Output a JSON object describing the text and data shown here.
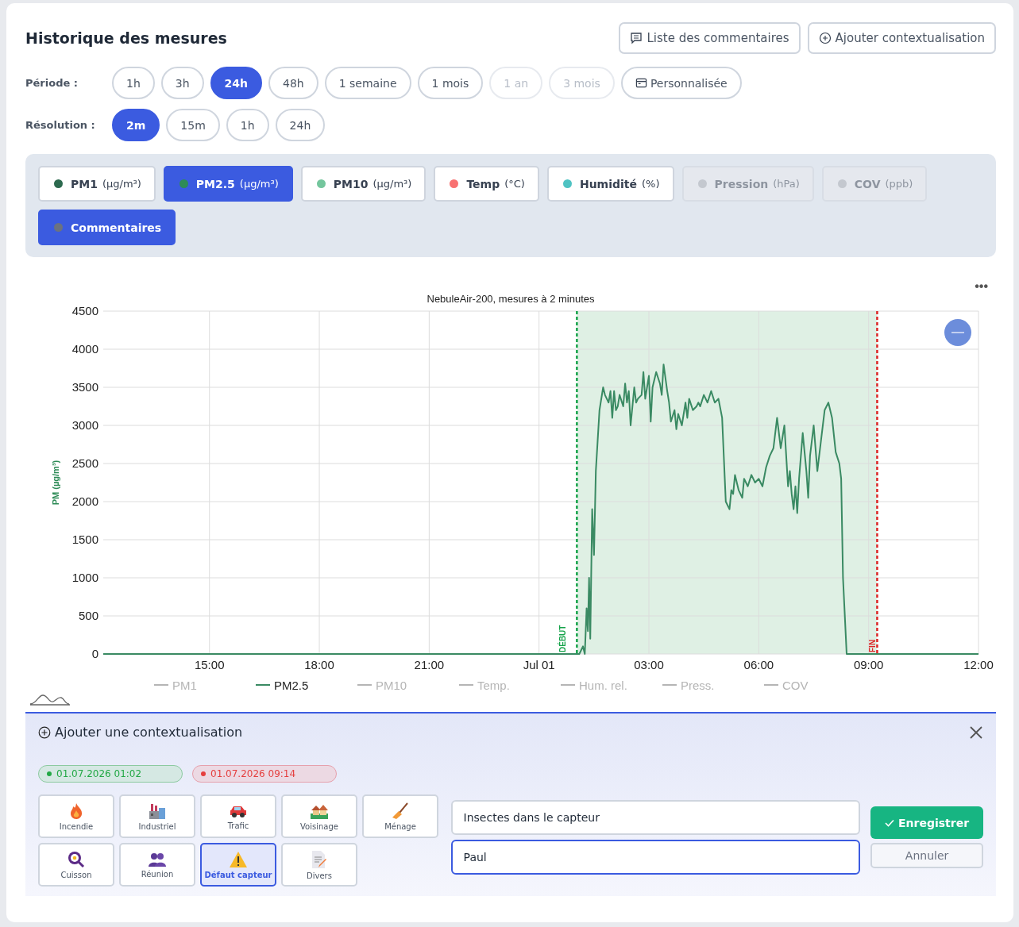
{
  "header": {
    "title": "Historique des mesures",
    "buttons": [
      {
        "label": "Liste des commentaires"
      },
      {
        "label": "Ajouter contextualisation"
      }
    ]
  },
  "period": {
    "label": "Période :",
    "options": [
      {
        "label": "1h",
        "selected": false,
        "disabled": false,
        "kind": "plain"
      },
      {
        "label": "3h",
        "selected": false,
        "disabled": false,
        "kind": "plain"
      },
      {
        "label": "24h",
        "selected": true,
        "disabled": false,
        "kind": "plain"
      },
      {
        "label": "48h",
        "selected": false,
        "disabled": false,
        "kind": "plain"
      },
      {
        "label": "1 semaine",
        "selected": false,
        "disabled": false,
        "kind": "plain"
      },
      {
        "label": "1 mois",
        "selected": false,
        "disabled": false,
        "kind": "plain"
      },
      {
        "label": "1 an",
        "selected": false,
        "disabled": true,
        "kind": "plain"
      },
      {
        "label": "3 mois",
        "selected": false,
        "disabled": true,
        "kind": "plain"
      },
      {
        "label": "Personnalisée",
        "selected": false,
        "disabled": false,
        "kind": "calendar"
      }
    ]
  },
  "resolution": {
    "label": "Résolution :",
    "options": [
      {
        "label": "2m",
        "selected": true
      },
      {
        "label": "15m",
        "selected": false
      },
      {
        "label": "1h",
        "selected": false
      },
      {
        "label": "24h",
        "selected": false
      }
    ]
  },
  "parameters": [
    {
      "label": "PM1",
      "unit": "(µg/m³)",
      "color": "#2d6a4f",
      "selected": false,
      "disabled": false
    },
    {
      "label": "PM2.5",
      "unit": "(µg/m³)",
      "color": "#2e8b57",
      "selected": true,
      "disabled": false
    },
    {
      "label": "PM10",
      "unit": "(µg/m³)",
      "color": "#74c69d",
      "selected": false,
      "disabled": false
    },
    {
      "label": "Temp",
      "unit": "(°C)",
      "color": "#f87171",
      "selected": false,
      "disabled": false
    },
    {
      "label": "Humidité",
      "unit": "(%)",
      "color": "#4fc3c3",
      "selected": false,
      "disabled": false
    },
    {
      "label": "Pression",
      "unit": "(hPa)",
      "color": "#c4c8cf",
      "selected": false,
      "disabled": true
    },
    {
      "label": "COV",
      "unit": "(ppb)",
      "color": "#c4c8cf",
      "selected": false,
      "disabled": true
    },
    {
      "label": "Commentaires",
      "color": "#6b7280",
      "selected": true,
      "disabled": false
    }
  ],
  "chart": {
    "menu": "•••",
    "legend": [
      {
        "label": "PM1",
        "visible": false
      },
      {
        "visible": true
      },
      {
        "label": "PM10",
        "visible": false
      },
      {
        "label": "Temp.",
        "visible": false
      },
      {
        "label": "Hum. rel.",
        "visible": false
      },
      {
        "label": "Press.",
        "visible": false
      },
      {
        "label": "COV",
        "visible": false
      }
    ],
    "chart_data": {
      "type": "line",
      "title": "NebuleAir-200, mesures à 2 minutes",
      "ylabel": "PM (µg/m³)",
      "grid": true,
      "xlim": [
        "2026-06-30T12:06",
        "2026-07-01T12:00"
      ],
      "ylim": [
        0,
        4500
      ],
      "xticks": [
        {
          "value": "2026-06-30T15:00",
          "label": "15:00"
        },
        {
          "value": "2026-06-30T18:00",
          "label": "18:00"
        },
        {
          "value": "2026-06-30T21:00",
          "label": "21:00"
        },
        {
          "value": "2026-07-01T00:00",
          "label": "Jul 01"
        },
        {
          "value": "2026-07-01T03:00",
          "label": "03:00"
        },
        {
          "value": "2026-07-01T06:00",
          "label": "06:00"
        },
        {
          "value": "2026-07-01T09:00",
          "label": "09:00"
        },
        {
          "value": "2026-07-01T12:00",
          "label": "12:00"
        }
      ],
      "yticks": [
        0,
        500,
        1000,
        1500,
        2000,
        2500,
        3000,
        3500,
        4000,
        4500
      ],
      "x": [
        "2026-06-30T12:06",
        "2026-07-01T01:00",
        "2026-07-01T01:06",
        "2026-07-01T01:09",
        "2026-07-01T01:12",
        "2026-07-01T01:15",
        "2026-07-01T01:18",
        "2026-07-01T01:20",
        "2026-07-01T01:22",
        "2026-07-01T01:24",
        "2026-07-01T01:27",
        "2026-07-01T01:30",
        "2026-07-01T01:33",
        "2026-07-01T01:36",
        "2026-07-01T01:39",
        "2026-07-01T01:45",
        "2026-07-01T01:48",
        "2026-07-01T01:54",
        "2026-07-01T01:57",
        "2026-07-01T02:00",
        "2026-07-01T02:03",
        "2026-07-01T02:06",
        "2026-07-01T02:09",
        "2026-07-01T02:12",
        "2026-07-01T02:18",
        "2026-07-01T02:21",
        "2026-07-01T02:24",
        "2026-07-01T02:27",
        "2026-07-01T02:30",
        "2026-07-01T02:36",
        "2026-07-01T02:39",
        "2026-07-01T02:42",
        "2026-07-01T02:48",
        "2026-07-01T02:51",
        "2026-07-01T02:54",
        "2026-07-01T03:00",
        "2026-07-01T03:03",
        "2026-07-01T03:06",
        "2026-07-01T03:12",
        "2026-07-01T03:18",
        "2026-07-01T03:21",
        "2026-07-01T03:24",
        "2026-07-01T03:30",
        "2026-07-01T03:33",
        "2026-07-01T03:36",
        "2026-07-01T03:42",
        "2026-07-01T03:45",
        "2026-07-01T03:48",
        "2026-07-01T03:54",
        "2026-07-01T04:00",
        "2026-07-01T04:03",
        "2026-07-01T04:06",
        "2026-07-01T04:12",
        "2026-07-01T04:18",
        "2026-07-01T04:21",
        "2026-07-01T04:24",
        "2026-07-01T04:30",
        "2026-07-01T04:36",
        "2026-07-01T04:42",
        "2026-07-01T04:48",
        "2026-07-01T04:54",
        "2026-07-01T05:00",
        "2026-07-01T05:06",
        "2026-07-01T05:12",
        "2026-07-01T05:15",
        "2026-07-01T05:18",
        "2026-07-01T05:21",
        "2026-07-01T05:27",
        "2026-07-01T05:33",
        "2026-07-01T05:36",
        "2026-07-01T05:42",
        "2026-07-01T05:48",
        "2026-07-01T05:54",
        "2026-07-01T06:00",
        "2026-07-01T06:06",
        "2026-07-01T06:12",
        "2026-07-01T06:18",
        "2026-07-01T06:24",
        "2026-07-01T06:30",
        "2026-07-01T06:36",
        "2026-07-01T06:42",
        "2026-07-01T06:48",
        "2026-07-01T06:51",
        "2026-07-01T06:54",
        "2026-07-01T06:57",
        "2026-07-01T07:00",
        "2026-07-01T07:03",
        "2026-07-01T07:06",
        "2026-07-01T07:12",
        "2026-07-01T07:18",
        "2026-07-01T07:21",
        "2026-07-01T07:24",
        "2026-07-01T07:30",
        "2026-07-01T07:36",
        "2026-07-01T07:42",
        "2026-07-01T07:48",
        "2026-07-01T07:54",
        "2026-07-01T08:00",
        "2026-07-01T08:06",
        "2026-07-01T08:12",
        "2026-07-01T08:15",
        "2026-07-01T08:18",
        "2026-07-01T08:24",
        "2026-07-01T08:30",
        "2026-07-01T08:36",
        "2026-07-01T08:42",
        "2026-07-01T08:45",
        "2026-07-01T08:48",
        "2026-07-01T08:51",
        "2026-07-01T12:00"
      ],
      "series": [
        {
          "name": "PM2.5",
          "color": "#3a8a63",
          "values": [
            0,
            0,
            0,
            50,
            100,
            0,
            600,
            300,
            1000,
            200,
            1900,
            1300,
            2400,
            2800,
            3200,
            3500,
            3400,
            3300,
            3450,
            3100,
            3450,
            3200,
            3250,
            3400,
            3250,
            3550,
            3300,
            3450,
            3000,
            3500,
            3300,
            3350,
            3400,
            3700,
            3350,
            3650,
            3050,
            3500,
            3700,
            3550,
            3400,
            3800,
            3450,
            3300,
            3050,
            3200,
            2950,
            3150,
            3000,
            3300,
            3100,
            3350,
            3200,
            3250,
            3300,
            3250,
            3400,
            3300,
            3450,
            3300,
            3350,
            3100,
            2000,
            1900,
            2150,
            2100,
            2350,
            2150,
            2050,
            2300,
            2200,
            2350,
            2250,
            2300,
            2200,
            2450,
            2600,
            2700,
            3100,
            2700,
            3000,
            2200,
            2400,
            2100,
            1900,
            2200,
            1850,
            2300,
            2900,
            2400,
            2050,
            2600,
            3000,
            2400,
            2800,
            3200,
            3300,
            3100,
            2650,
            2500,
            2300,
            1000,
            0,
            0,
            0,
            0,
            0,
            0,
            0,
            0
          ]
        }
      ],
      "bands": [
        {
          "axis": "x",
          "from": "2026-07-01T01:02",
          "to": "2026-07-01T09:14",
          "color": "#dff0e4"
        }
      ],
      "ref_lines": [
        {
          "axis": "x",
          "value": "2026-07-01T01:02",
          "label": "DÉBUT",
          "color": "#16a34a"
        },
        {
          "axis": "x",
          "value": "2026-07-01T09:14",
          "label": "FIN",
          "color": "#dc2626"
        }
      ]
    }
  },
  "context_panel": {
    "title": "Ajouter une contextualisation",
    "dates": [
      {
        "text": "01.07.2026 01:02",
        "kind": "start",
        "color": "#22a845"
      },
      {
        "text": "01.07.2026 09:14",
        "kind": "end",
        "color": "#e53e3e"
      }
    ],
    "categories": [
      {
        "label": "Incendie",
        "selected": false
      },
      {
        "label": "Industriel",
        "selected": false
      },
      {
        "label": "Trafic",
        "selected": false
      },
      {
        "label": "Voisinage",
        "selected": false
      },
      {
        "label": "Ménage",
        "selected": false
      },
      {
        "label": "Cuisson",
        "selected": false
      },
      {
        "label": "Réunion",
        "selected": false
      },
      {
        "label": "Défaut capteur",
        "selected": true
      },
      {
        "label": "Divers",
        "selected": false
      }
    ],
    "comment": {
      "value": "Insectes dans le capteur",
      "focused": false
    },
    "author": {
      "value": "Paul",
      "focused": true
    },
    "save_button": "Enregistrer",
    "cancel_button": "Annuler"
  }
}
